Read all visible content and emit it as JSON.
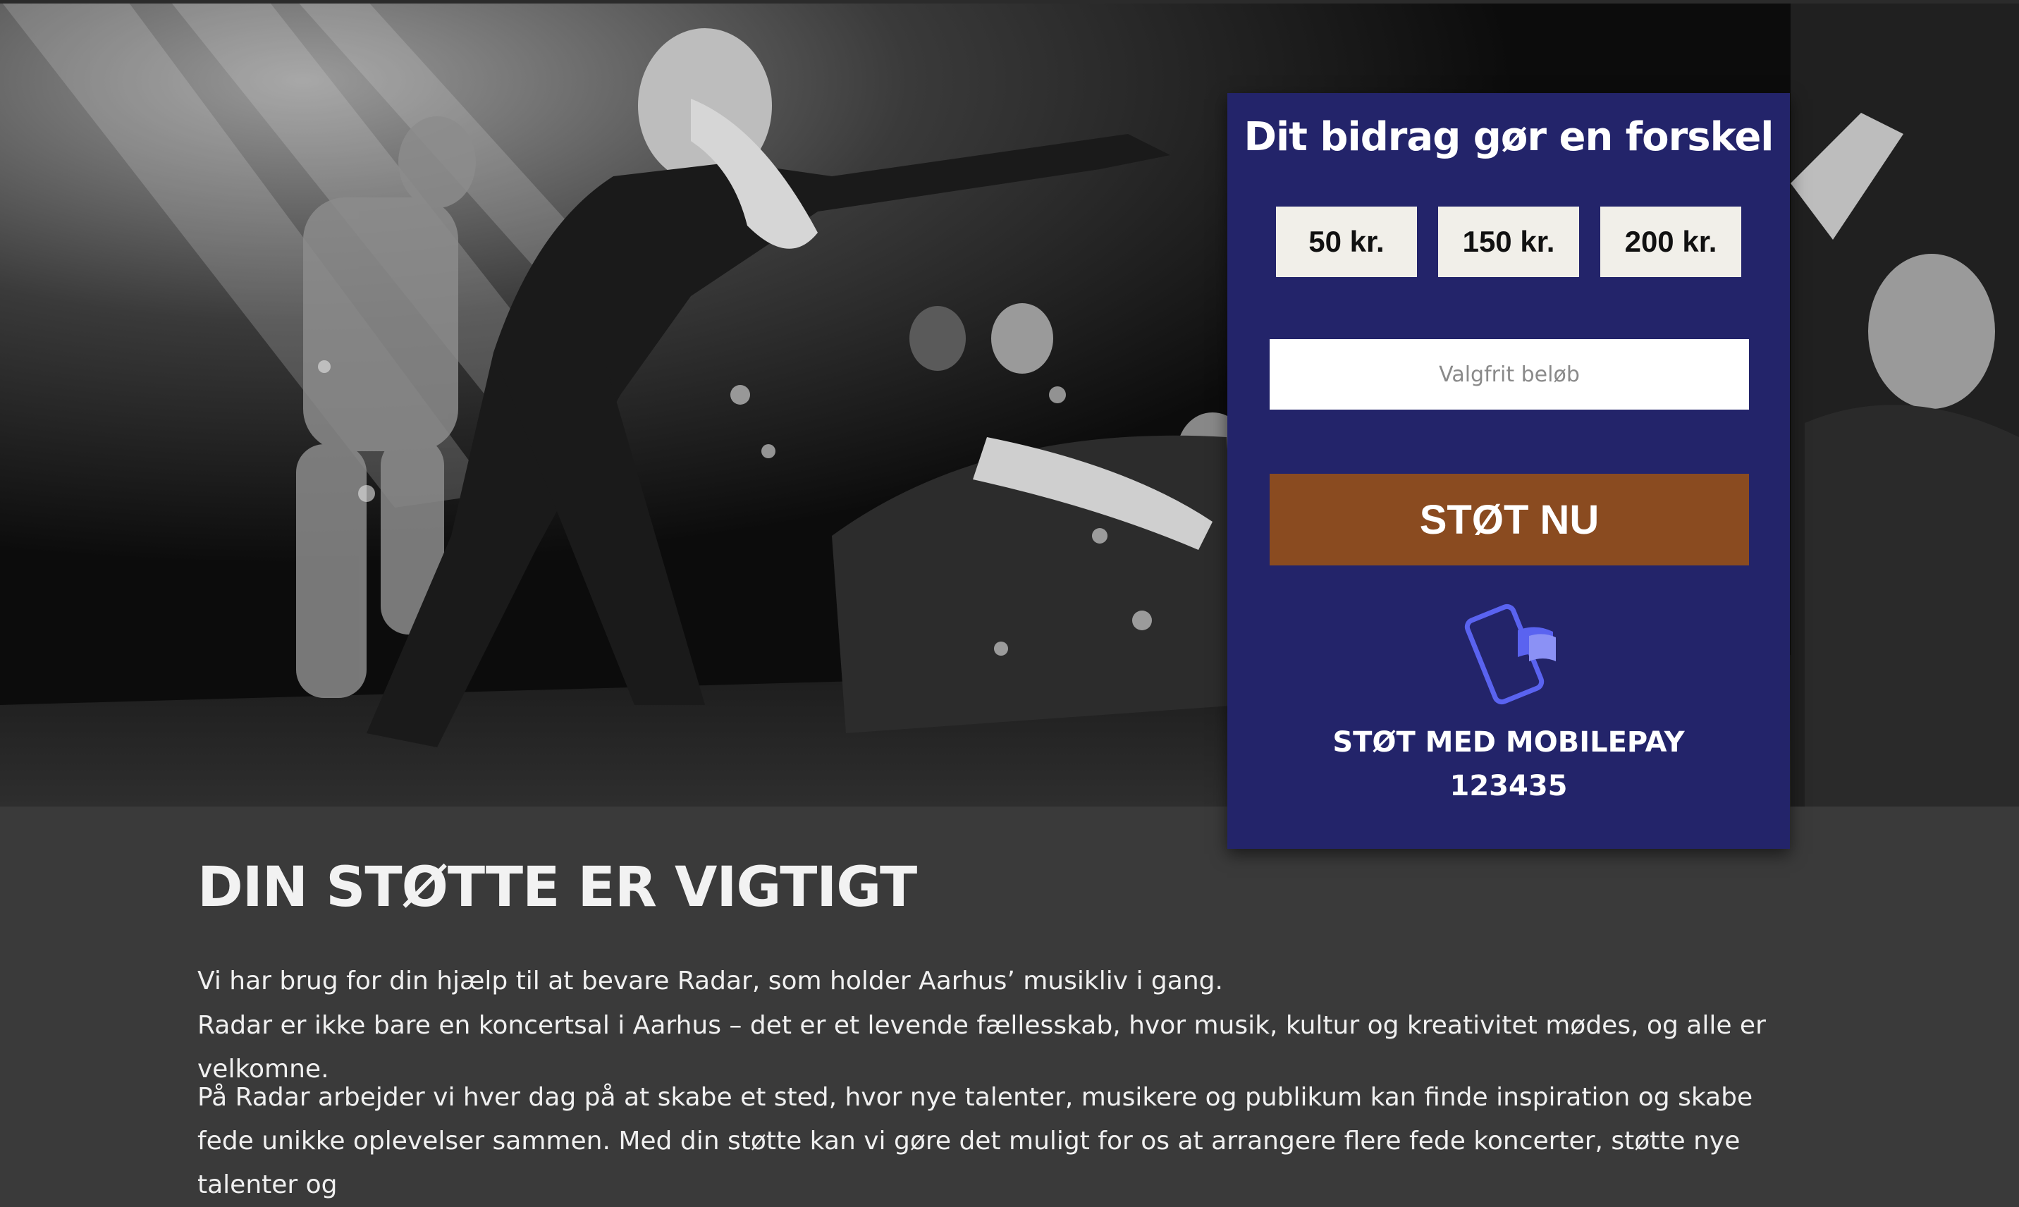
{
  "hero": {
    "image_description": "black-and-white concert photo"
  },
  "donate": {
    "title": "Dit bidrag gør en forskel",
    "amounts": [
      "50 kr.",
      "150 kr.",
      "200 kr."
    ],
    "custom_placeholder": "Valgfrit beløb",
    "support_button": "STØT NU",
    "mobilepay_line1": "STØT MED MOBILEPAY",
    "mobilepay_number": "123435",
    "colors": {
      "card": "#23246a",
      "button": "#8a4b20",
      "mobilepay_icon": "#5a63f0"
    }
  },
  "content": {
    "heading": "DIN STØTTE ER VIGTIGT",
    "p1": "Vi har brug for din hjælp til at bevare Radar, som holder Aarhus’ musikliv i gang.",
    "p2": "Radar er ikke bare en koncertsal i Aarhus – det er et levende fællesskab, hvor musik, kultur og kreativitet mødes, og alle er velkomne.",
    "p3": "På Radar arbejder vi hver dag på at skabe et sted, hvor nye talenter, musikere og publikum kan finde inspiration og skabe fede unikke oplevelser sammen. Med din støtte kan vi gøre det muligt for os at arrangere flere fede koncerter, støtte nye talenter og"
  }
}
